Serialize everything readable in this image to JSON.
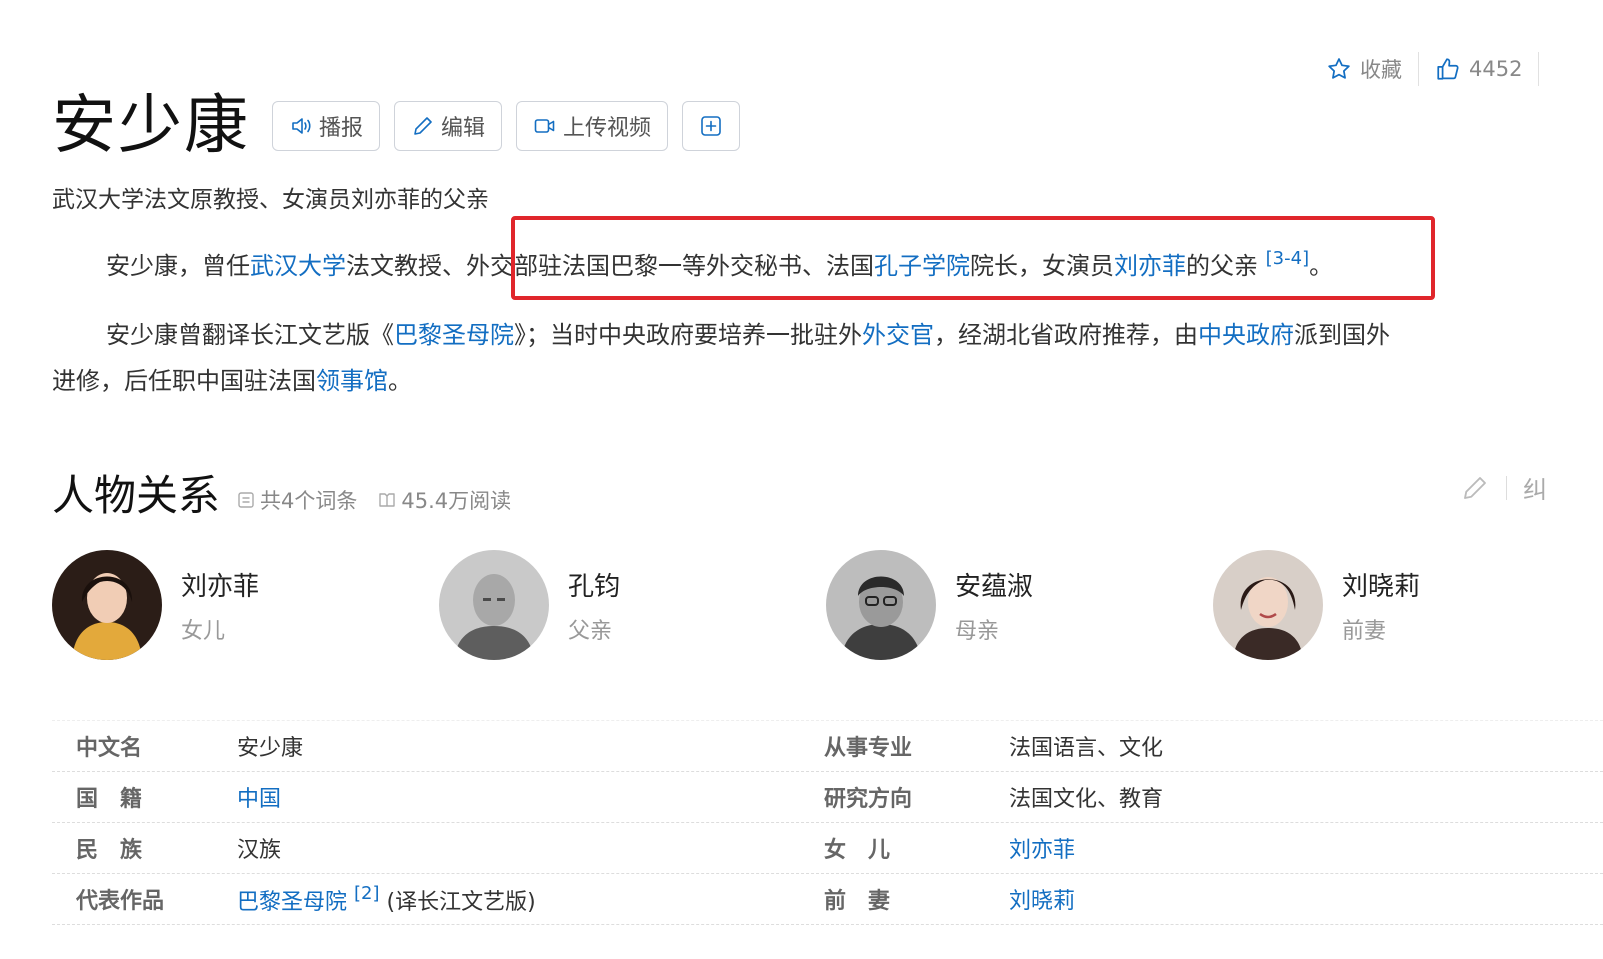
{
  "top_actions": {
    "favorite_label": "收藏",
    "like_count": "4452"
  },
  "title": "安少康",
  "toolbar": {
    "broadcast": "播报",
    "edit": "编辑",
    "upload_video": "上传视频"
  },
  "subtitle": "武汉大学法文原教授、女演员刘亦菲的父亲",
  "para1": {
    "t1": "安少康，曾任",
    "l1": "武汉大学",
    "t2": "法文教授、",
    "t3": "外交部驻法国巴黎一等外交秘书、法国",
    "l2": "孔子学院",
    "t4": "院长，女演员",
    "l3": "刘亦菲",
    "t5": "的父亲",
    "ref": "[3-4]",
    "t6": "。"
  },
  "para2": {
    "t1": "安少康曾翻译长江文艺版《",
    "l1": "巴黎圣母院",
    "t2": "》；当时中央政府要培养一批驻外",
    "l2": "外交官",
    "t3": "，经湖北省政府推荐，由",
    "l3": "中央政府",
    "t4": "派到国外",
    "t5": "进修，后任职中国驻法国",
    "l4": "领事馆",
    "t6": "。"
  },
  "relations": {
    "title": "人物关系",
    "count": "共4个词条",
    "reads": "45.4万阅读",
    "correct": "纠",
    "people": [
      {
        "name": "刘亦菲",
        "role": "女儿"
      },
      {
        "name": "孔钧",
        "role": "父亲"
      },
      {
        "name": "安蕴淑",
        "role": "母亲"
      },
      {
        "name": "刘晓莉",
        "role": "前妻"
      }
    ]
  },
  "info": {
    "rows": [
      {
        "k1": "中文名",
        "v1": "安少康",
        "k2": "从事专业",
        "v2": "法国语言、文化"
      },
      {
        "k1": "国　籍",
        "v1": "中国",
        "k2": "研究方向",
        "v2": "法国文化、教育"
      },
      {
        "k1": "民　族",
        "v1": "汉族",
        "k2": "女　儿",
        "v2": "刘亦菲"
      },
      {
        "k1": "代表作品",
        "v1": "巴黎圣母院",
        "v1_ref": "[2]",
        "v1_extra": "(译长江文艺版)",
        "k2": "前　妻",
        "v2": "刘晓莉"
      }
    ]
  },
  "colors": {
    "link": "#136ec2",
    "highlight": "#e0262b"
  }
}
